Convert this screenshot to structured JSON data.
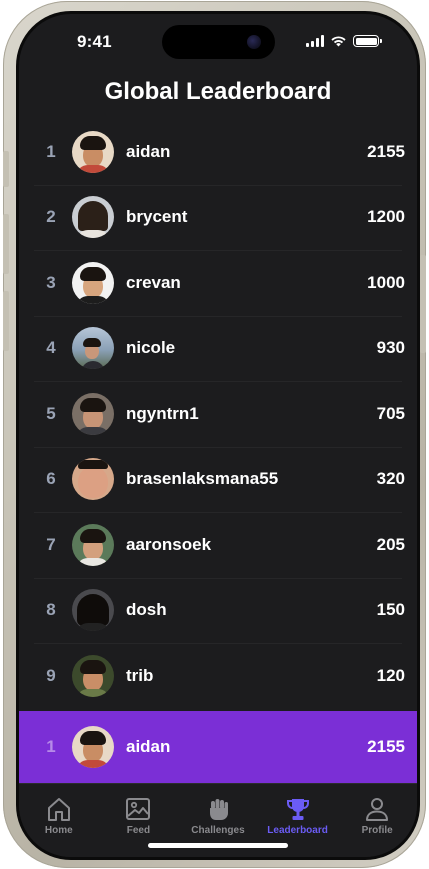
{
  "status_bar": {
    "time": "9:41"
  },
  "title": "Global Leaderboard",
  "leaderboard": [
    {
      "rank": "1",
      "username": "aidan",
      "score": "2155"
    },
    {
      "rank": "2",
      "username": "brycent",
      "score": "1200"
    },
    {
      "rank": "3",
      "username": "crevan",
      "score": "1000"
    },
    {
      "rank": "4",
      "username": "nicole",
      "score": "930"
    },
    {
      "rank": "5",
      "username": "ngyntrn1",
      "score": "705"
    },
    {
      "rank": "6",
      "username": "brasenlaksmana55",
      "score": "320"
    },
    {
      "rank": "7",
      "username": "aaronsoek",
      "score": "205"
    },
    {
      "rank": "8",
      "username": "dosh",
      "score": "150"
    },
    {
      "rank": "9",
      "username": "trib",
      "score": "120"
    }
  ],
  "current_user": {
    "rank": "1",
    "username": "aidan",
    "score": "2155"
  },
  "tabs": [
    {
      "label": "Home",
      "icon": "home-icon",
      "active": false
    },
    {
      "label": "Feed",
      "icon": "image-icon",
      "active": false
    },
    {
      "label": "Challenges",
      "icon": "fist-icon",
      "active": false
    },
    {
      "label": "Leaderboard",
      "icon": "trophy-icon",
      "active": true
    },
    {
      "label": "Profile",
      "icon": "person-icon",
      "active": false
    }
  ],
  "colors": {
    "background": "#1c1c1e",
    "highlight_row": "#7b2fd6",
    "active_tab": "#6b5cf5",
    "inactive_tab": "#8a8a8e",
    "rank_text": "#9aa3b5"
  }
}
